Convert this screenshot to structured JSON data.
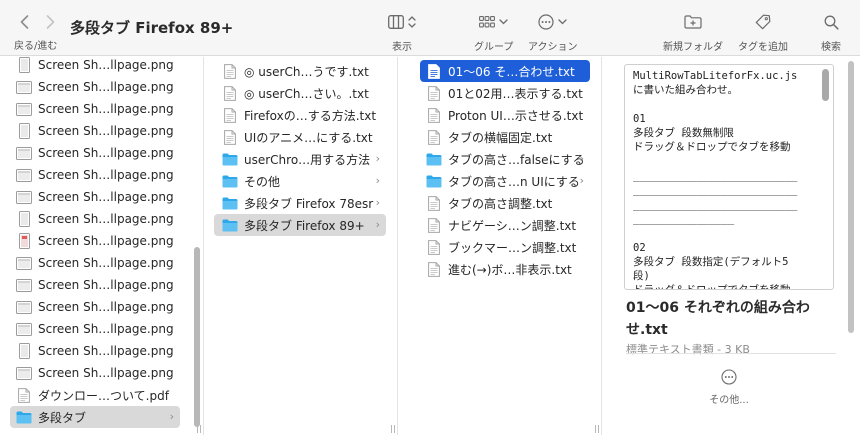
{
  "window": {
    "title": "多段タブ Firefox 89+"
  },
  "toolbar": {
    "back_forward_label": "戻る/進む",
    "view_label": "表示",
    "group_label": "グループ",
    "action_label": "アクション",
    "new_folder_label": "新規フォルダ",
    "add_tag_label": "タグを追加",
    "search_label": "検索"
  },
  "column1": {
    "items": [
      {
        "name": "Screen Sh…llpage.png",
        "kind": "image-tall"
      },
      {
        "name": "Screen Sh…llpage.png",
        "kind": "image"
      },
      {
        "name": "Screen Sh…llpage.png",
        "kind": "image"
      },
      {
        "name": "Screen Sh…llpage.png",
        "kind": "image-tall"
      },
      {
        "name": "Screen Sh…llpage.png",
        "kind": "image"
      },
      {
        "name": "Screen Sh…llpage.png",
        "kind": "image"
      },
      {
        "name": "Screen Sh…llpage.png",
        "kind": "image"
      },
      {
        "name": "Screen Sh…llpage.png",
        "kind": "image-tall"
      },
      {
        "name": "Screen Sh…llpage.png",
        "kind": "image-red"
      },
      {
        "name": "Screen Sh…llpage.png",
        "kind": "image"
      },
      {
        "name": "Screen Sh…llpage.png",
        "kind": "image"
      },
      {
        "name": "Screen Sh…llpage.png",
        "kind": "image"
      },
      {
        "name": "Screen Sh…llpage.png",
        "kind": "image"
      },
      {
        "name": "Screen Sh…llpage.png",
        "kind": "image-tall"
      },
      {
        "name": "Screen Sh…llpage.png",
        "kind": "image"
      },
      {
        "name": "ダウンロー…ついて.pdf",
        "kind": "pdf"
      },
      {
        "name": "多段タブ",
        "kind": "folder",
        "selected": true
      }
    ]
  },
  "column2": {
    "items": [
      {
        "name": "◎ userCh…うです.txt",
        "kind": "txt"
      },
      {
        "name": "◎ userCh…さい。.txt",
        "kind": "txt"
      },
      {
        "name": "Firefoxの…する方法.txt",
        "kind": "txt"
      },
      {
        "name": "UIのアニメ…にする.txt",
        "kind": "txt"
      },
      {
        "name": "userChro…用する方法",
        "kind": "folder"
      },
      {
        "name": "その他",
        "kind": "folder"
      },
      {
        "name": "多段タブ Firefox 78esr",
        "kind": "folder"
      },
      {
        "name": "多段タブ Firefox 89+",
        "kind": "folder",
        "selected": true
      }
    ]
  },
  "column3": {
    "items": [
      {
        "name": "01〜06 そ…合わせ.txt",
        "kind": "txt",
        "selected": true
      },
      {
        "name": "01と02用…表示する.txt",
        "kind": "txt"
      },
      {
        "name": "Proton UI…示させる.txt",
        "kind": "txt"
      },
      {
        "name": "タブの横幅固定.txt",
        "kind": "txt"
      },
      {
        "name": "タブの高さ…falseにする",
        "kind": "folder"
      },
      {
        "name": "タブの高さ…n UIにする",
        "kind": "folder"
      },
      {
        "name": "タブの高さ調整.txt",
        "kind": "txt"
      },
      {
        "name": "ナビゲーシ…ン調整.txt",
        "kind": "txt"
      },
      {
        "name": "ブックマー…ン調整.txt",
        "kind": "txt"
      },
      {
        "name": "進む(→)ボ…非表示.txt",
        "kind": "txt"
      }
    ]
  },
  "preview": {
    "content": "MultiRowTabLiteforFx.uc.js\nに書いた組み合わせ。\n\n01\n多段タブ 段数無制限\nドラッグ＆ドロップでタブを移動\n\n__________________________\n__________________________\n__________________________\n________________\n\n02\n多段タブ 段数指定(デフォルト5\n段)\nドラッグ＆ドロップでタブを移動",
    "file_name": "01〜06 それぞれの組み合わせ.txt",
    "file_meta": "標準テキスト書類 - 3 KB",
    "other_label": "その他..."
  },
  "colors": {
    "accent": "#1e5fd9",
    "folder": "#2fa8ea",
    "selection_gray": "#d9d9d9"
  }
}
